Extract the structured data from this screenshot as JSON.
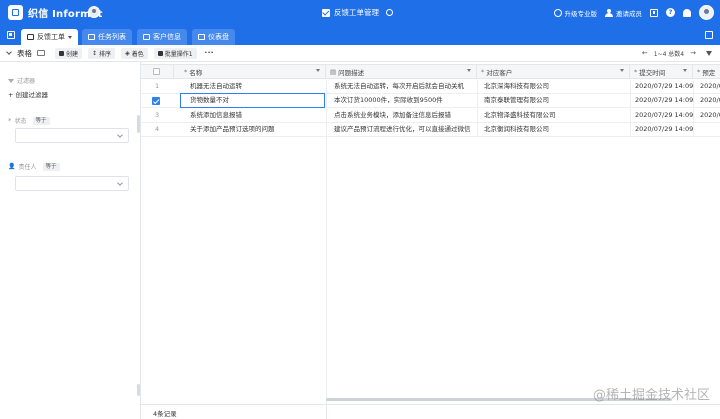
{
  "app": {
    "brand": "织信 Informat",
    "title": "反馈工单管理"
  },
  "header": {
    "upgrade_label": "升级专业版",
    "invite_label": "邀请成员"
  },
  "tabs": [
    {
      "label": "反馈工单",
      "active": true
    },
    {
      "label": "任务列表",
      "active": false
    },
    {
      "label": "客户信息",
      "active": false
    },
    {
      "label": "仪表盘",
      "active": false
    }
  ],
  "toolbar": {
    "view_label": "表格",
    "create_label": "创建",
    "sort_label": "排序",
    "color_label": "着色",
    "batch_label": "批量操作1",
    "more_label": "···",
    "pager_label": "1~4 总数4"
  },
  "left_panel": {
    "filter_label": "过滤器",
    "add_filter_label": "创建过滤器",
    "status_label": "状态",
    "status_op": "等于",
    "owner_label": "责任人",
    "owner_op": "等于"
  },
  "table": {
    "columns": [
      {
        "label": "名称",
        "icon": "*"
      },
      {
        "label": "问题描述",
        "icon": "▤"
      },
      {
        "label": "对应客户",
        "icon": "*"
      },
      {
        "label": "提交时间",
        "icon": "*"
      },
      {
        "label": "预定",
        "icon": "*"
      }
    ],
    "rows": [
      {
        "index": "1",
        "name": "机器无法自动运转",
        "desc": "系统无法自动运转，每次开启后就会自动关机",
        "customer": "北京深海科技有限公司",
        "time": "2020/07/29 14:09",
        "extra": "2020/0",
        "selected": false
      },
      {
        "index": "2",
        "name": "货物数量不对",
        "desc": "本次订货10000件，实际收到9500件",
        "customer": "南京泰联管理有限公司",
        "time": "2020/07/29 14:09",
        "extra": "2020/0",
        "selected": true
      },
      {
        "index": "3",
        "name": "系统添加信息报错",
        "desc": "点击系统业务模块，添加备注信息后报错",
        "customer": "北京物泽盛科技有限公司",
        "time": "2020/07/29 14:09",
        "extra": "2020/0",
        "selected": false
      },
      {
        "index": "4",
        "name": "关于添加产品预订选项的问题",
        "desc": "建议产品预订流程进行优化，可以直接通过微信",
        "customer": "北京衡润科技有限公司",
        "time": "2020/07/29 14:09",
        "extra": "",
        "selected": false
      }
    ],
    "footer_label": "4条记录"
  },
  "watermark": "@稀土掘金技术社区",
  "colors": {
    "primary": "#1e6fe8",
    "selection": "#2f80ed"
  }
}
